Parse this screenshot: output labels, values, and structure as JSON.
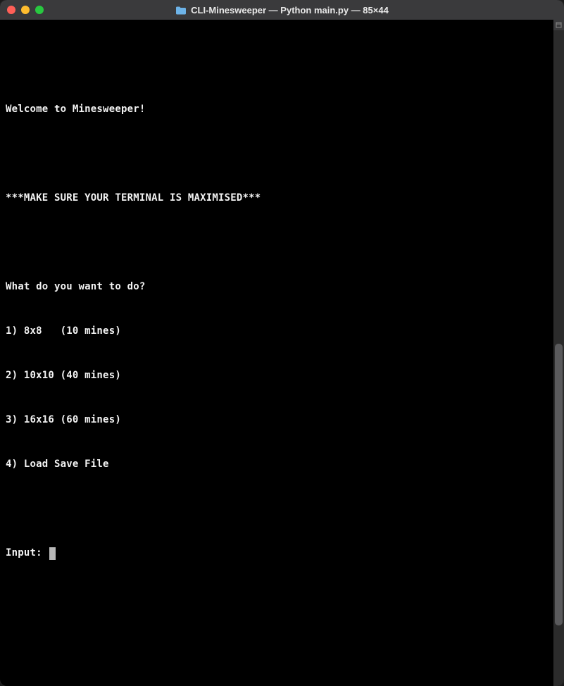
{
  "titlebar": {
    "title": "CLI-Minesweeper — Python main.py — 85×44"
  },
  "terminal": {
    "lines": [
      "",
      "Welcome to Minesweeper!",
      "",
      "***MAKE SURE YOUR TERMINAL IS MAXIMISED***",
      "",
      "What do you want to do?",
      "1) 8x8   (10 mines)",
      "2) 10x10 (40 mines)",
      "3) 16x16 (60 mines)",
      "4) Load Save File",
      ""
    ],
    "prompt_label": "Input: "
  }
}
